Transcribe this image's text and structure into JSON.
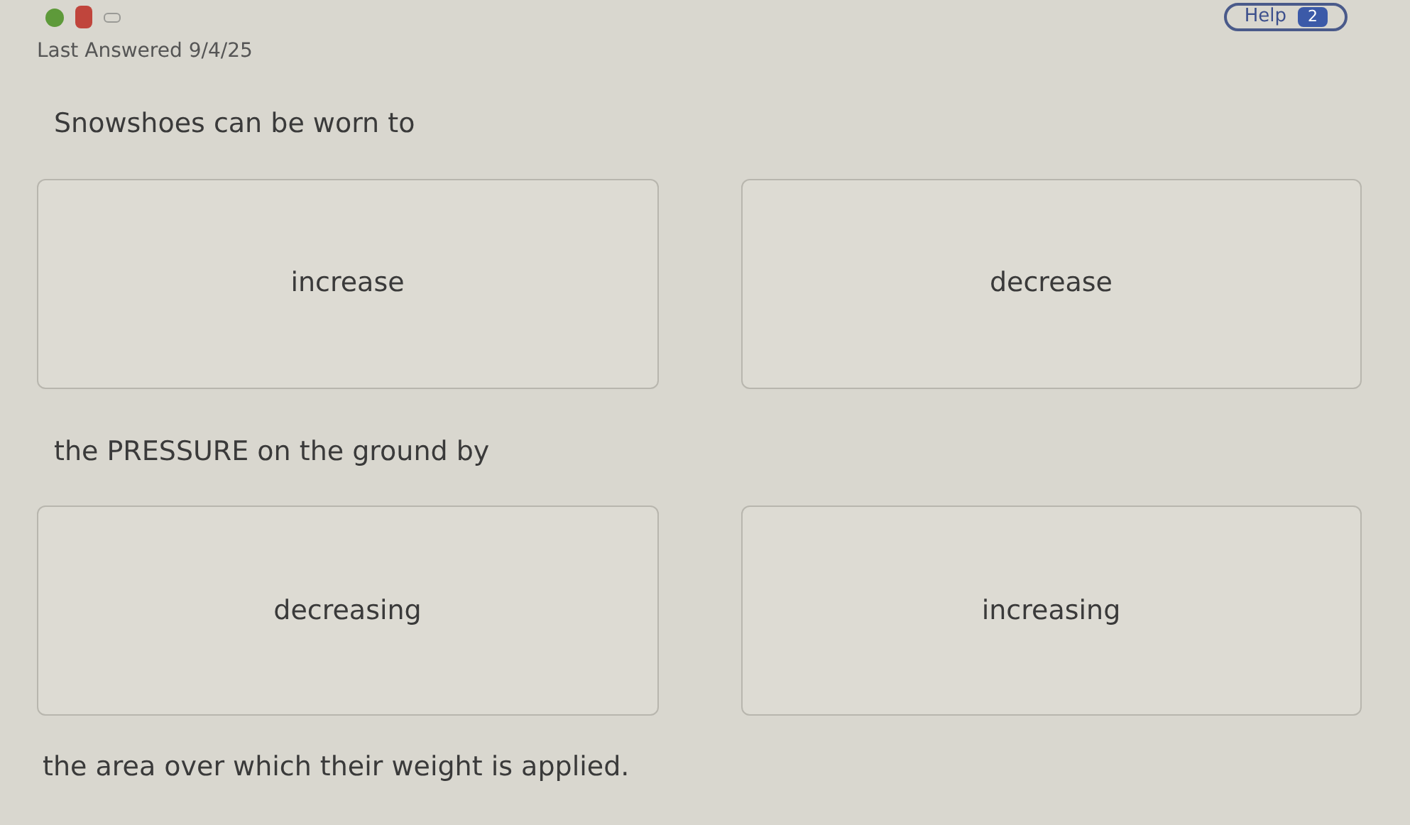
{
  "history": [
    {
      "color": "#5e9a3a",
      "kind": "dot"
    },
    {
      "color": "#c0453c",
      "kind": "bar"
    },
    {
      "color": "#9a9a96",
      "kind": "empty"
    }
  ],
  "help_button": {
    "label": "Help",
    "badge": "2"
  },
  "last_answered": "Last Answered 9/4/25",
  "segments": [
    {
      "text": "Snowshoes can be worn to",
      "choices": [
        {
          "label": "increase",
          "selected": false
        },
        {
          "label": "decrease",
          "selected": false
        }
      ]
    },
    {
      "text": "the PRESSURE on the ground by",
      "choices": [
        {
          "label": "decreasing",
          "selected": false
        },
        {
          "label": "increasing",
          "selected": false
        }
      ]
    }
  ],
  "ending": "the area over which their weight is applied."
}
